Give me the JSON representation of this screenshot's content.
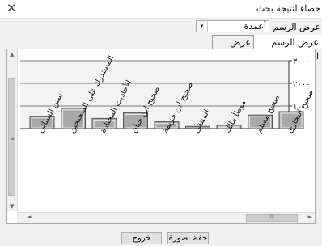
{
  "window": {
    "title": "حصاء لنتيجة بحث",
    "close_glyph": "✕"
  },
  "chart_type": {
    "label": "عرض الرسم",
    "selected": "أعمدة",
    "arrow": "▾"
  },
  "tabs": [
    {
      "label": "عرض الرسم التوضيحي"
    },
    {
      "label": "عرض جدولي"
    }
  ],
  "scroll": {
    "up": "▲",
    "down": "▼",
    "left": "◄",
    "right": "►",
    "grip_v": "≡",
    "grip_h": "|||"
  },
  "buttons": {
    "exit": "خروج",
    "save": "حفظ صورة"
  },
  "chart_data": {
    "type": "bar",
    "categories": [
      "سنن النسائي",
      "المستدرك على الصحيحين",
      "الأحاديث المختارة",
      "صحيح ابن حبان",
      "صحيح ابن خزيمة",
      "المنتقى",
      "موطأ مالك",
      "صحيح مسلم",
      "صحيح البخاري"
    ],
    "values": [
      550,
      900,
      450,
      700,
      300,
      100,
      150,
      600,
      750
    ],
    "ylim": [
      0,
      3000
    ],
    "yticks": [
      "٠",
      "١٠٠٠",
      "٢٠٠٠",
      "٣٠٠٠"
    ],
    "bar_color": "#a9a9a9",
    "grid": true
  }
}
